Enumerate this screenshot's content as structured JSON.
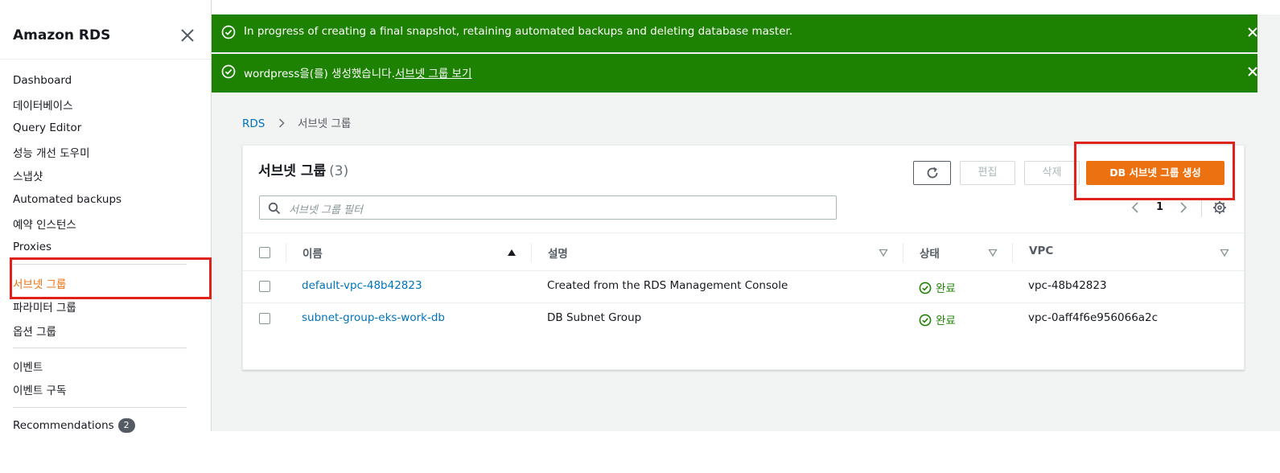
{
  "sidebar": {
    "title": "Amazon RDS",
    "items": [
      {
        "label": "Dashboard"
      },
      {
        "label": "데이터베이스"
      },
      {
        "label": "Query Editor"
      },
      {
        "label": "성능 개선 도우미"
      },
      {
        "label": "스냅샷"
      },
      {
        "label": "Automated backups"
      },
      {
        "label": "예약 인스턴스"
      },
      {
        "label": "Proxies"
      },
      {
        "label": "서브넷 그룹"
      },
      {
        "label": "파라미터 그룹"
      },
      {
        "label": "옵션 그룹"
      },
      {
        "label": "이벤트"
      },
      {
        "label": "이벤트 구독"
      },
      {
        "label": "Recommendations",
        "badge": "2"
      }
    ],
    "active_item": "서브넷 그룹"
  },
  "flash": {
    "message1": "In progress of creating a final snapshot, retaining automated backups and deleting database master.",
    "message2_text": "wordpress을(를) 생성했습니다.",
    "message2_link": "서브넷 그룹 보기"
  },
  "breadcrumb": {
    "root": "RDS",
    "current": "서브넷 그룹"
  },
  "panel": {
    "title": "서브넷 그룹",
    "count": "(3)",
    "edit_label": "편집",
    "delete_label": "삭제",
    "create_label": "DB 서브넷 그룹 생성",
    "search_placeholder": "서브넷 그룹 필터",
    "page": "1"
  },
  "table": {
    "columns": {
      "name": "이름",
      "description": "설명",
      "status": "상태",
      "vpc": "VPC"
    },
    "rows": [
      {
        "name": "default-vpc-48b42823",
        "description": "Created from the RDS Management Console",
        "status": "완료",
        "vpc": "vpc-48b42823"
      },
      {
        "name": "subnet-group-eks-work-db",
        "description": "DB Subnet Group",
        "status": "완료",
        "vpc": "vpc-0aff4f6e956066a2c"
      }
    ]
  },
  "colors": {
    "accent": "#ec7211",
    "success": "#1d8102",
    "link": "#0073bb",
    "highlight": "#e0221c"
  },
  "icons": [
    "close-icon",
    "check-circle-icon",
    "chevron-right-icon",
    "refresh-icon",
    "search-icon",
    "chevron-left-icon",
    "gear-icon",
    "sort-ascending-icon",
    "sort-icon"
  ]
}
